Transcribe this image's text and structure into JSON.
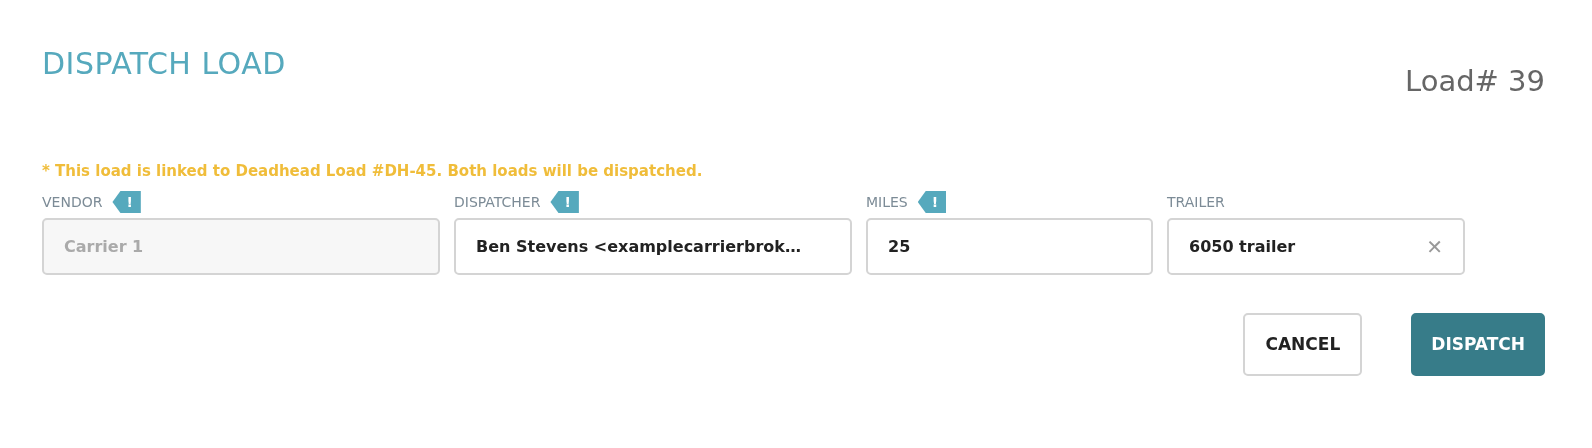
{
  "dialog": {
    "title": "DISPATCH LOAD",
    "load_number": "Load# 39"
  },
  "notice": "* This load is linked to Deadhead Load #DH-45. Both loads will be dispatched.",
  "fields": [
    {
      "label": "VENDOR",
      "flag": "!",
      "value": "Carrier 1",
      "disabled": true,
      "kind": "text"
    },
    {
      "label": "DISPATCHER",
      "flag": "!",
      "value": "Ben Stevens <examplecarrierbrok…",
      "disabled": false,
      "kind": "text"
    },
    {
      "label": "MILES",
      "flag": "!",
      "value": "25",
      "disabled": false,
      "kind": "text"
    },
    {
      "label": "TRAILER",
      "value": "6050 trailer",
      "disabled": false,
      "kind": "clearable",
      "clear": "✕"
    }
  ],
  "buttons": [
    {
      "label": "CANCEL",
      "kind": "secondary"
    },
    {
      "label": "DISPATCH",
      "kind": "primary"
    }
  ]
}
